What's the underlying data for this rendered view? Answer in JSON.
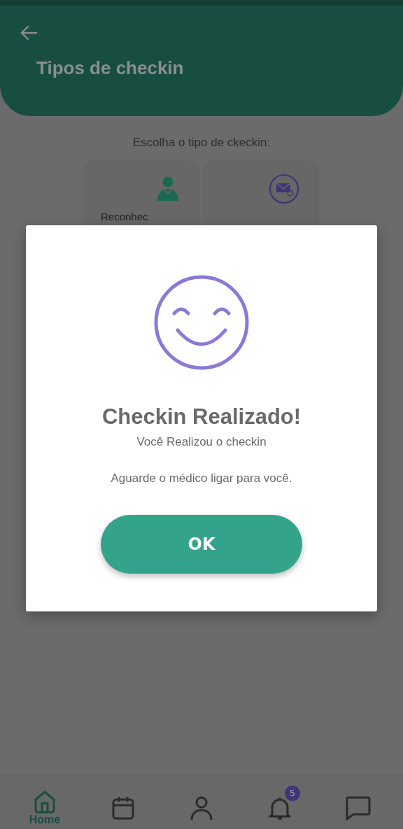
{
  "header": {
    "title": "Tipos de checkin"
  },
  "prompt": "Escolha o tipo de ckeckin:",
  "options": [
    {
      "kind": "doctor",
      "label": "Reconhec"
    },
    {
      "kind": "mail"
    }
  ],
  "dialog": {
    "title": "Checkin Realizado!",
    "subtitle": "Você Realizou o checkin",
    "message": "Aguarde o médico ligar para você.",
    "button": "OK"
  },
  "nav": [
    {
      "kind": "home",
      "label": "Home",
      "selected": true
    },
    {
      "kind": "calendar",
      "selected": false
    },
    {
      "kind": "profile",
      "selected": false
    },
    {
      "kind": "bell",
      "badge": "5",
      "selected": false
    },
    {
      "kind": "chat",
      "selected": false
    }
  ]
}
